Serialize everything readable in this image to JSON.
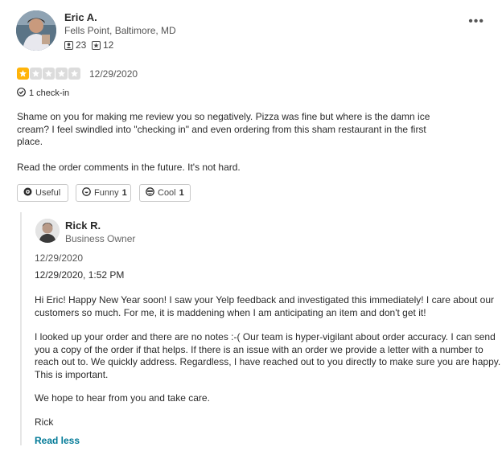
{
  "review": {
    "user_name": "Eric A.",
    "location": "Fells Point, Baltimore, MD",
    "friends_count": "23",
    "reviews_count": "12",
    "rating": 1,
    "date": "12/29/2020",
    "checkin_text": "1 check-in",
    "body": [
      "Shame on you for making me review you so negatively. Pizza was fine but where is the damn ice",
      "cream? I feel swindled into \"checking in\" and even ordering from this sham restaurant in the first",
      "place."
    ],
    "body2": "Read the order comments in the future. It's not hard.",
    "reactions": {
      "useful_label": "Useful",
      "funny_label": "Funny",
      "funny_count": "1",
      "cool_label": "Cool",
      "cool_count": "1"
    }
  },
  "owner_reply": {
    "name": "Rick R.",
    "role": "Business Owner",
    "date": "12/29/2020",
    "datetime": "12/29/2020, 1:52 PM",
    "p1": [
      "Hi Eric! Happy New Year soon! I saw your Yelp feedback and investigated this immediately! I care about our",
      "customers so much. For me, it is maddening when I am anticipating an item and don't get it!"
    ],
    "p2": [
      "I looked up your order and there are no notes :-(  Our team is hyper-vigilant about order accuracy. I can send",
      "you a copy of the order if that helps. If there is an issue with an order we provide a letter with a number to",
      "reach out to. We quickly address. Regardless, I have reached out to you directly to make sure you are happy.",
      "This is important."
    ],
    "p3": "We hope to hear from you and take care.",
    "signoff": "Rick",
    "read_less": "Read less"
  },
  "colors": {
    "star": "#ffb40a",
    "link": "#027a97"
  }
}
